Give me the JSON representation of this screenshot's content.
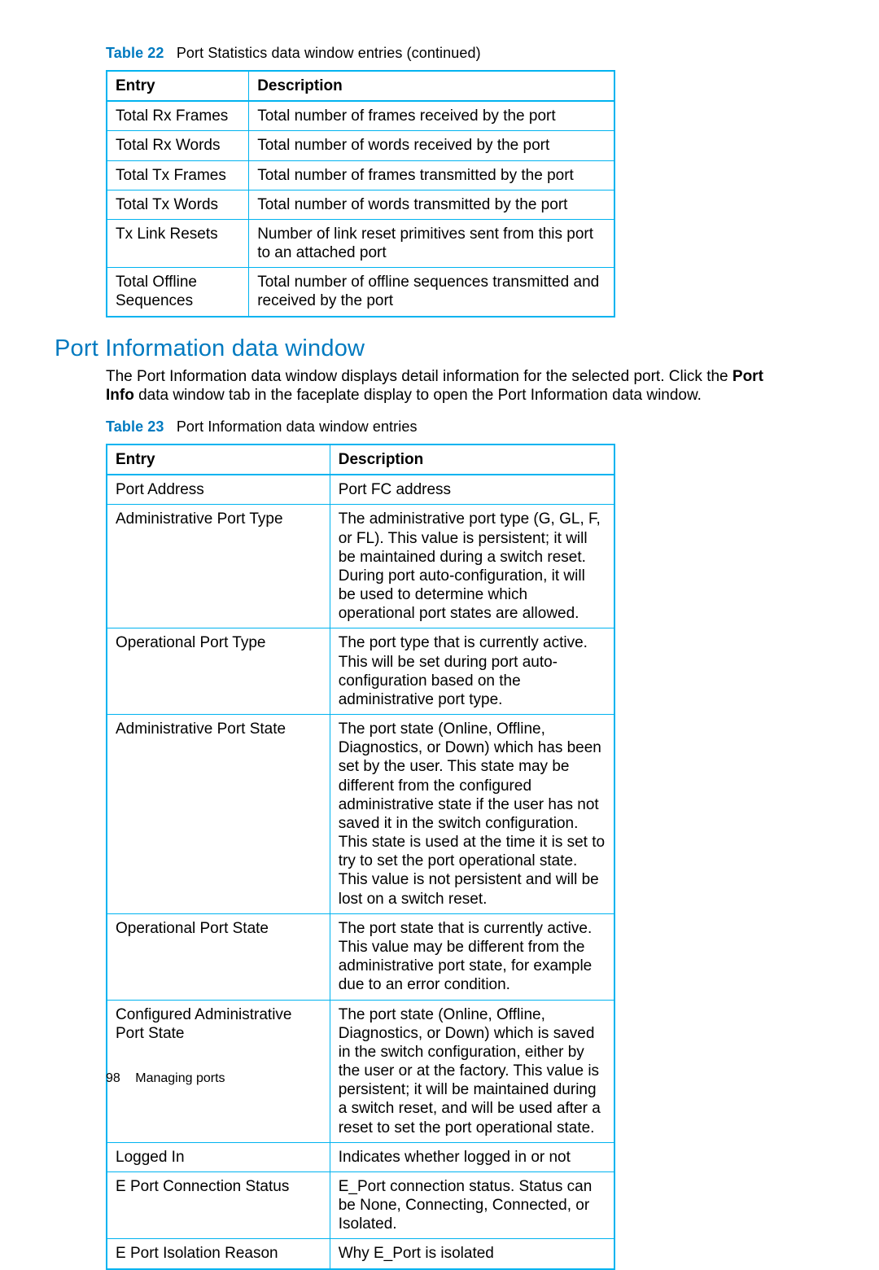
{
  "table22": {
    "label": "Table 22",
    "caption": "Port Statistics data window entries  (continued)",
    "headers": {
      "entry": "Entry",
      "description": "Description"
    },
    "rows": [
      {
        "entry": "Total Rx Frames",
        "description": "Total number of frames received by the port"
      },
      {
        "entry": "Total Rx Words",
        "description": "Total number of words received by the port"
      },
      {
        "entry": "Total Tx Frames",
        "description": "Total number of frames transmitted by the port"
      },
      {
        "entry": "Total Tx Words",
        "description": "Total number of words transmitted by the port"
      },
      {
        "entry": "Tx Link Resets",
        "description": "Number of link reset primitives sent from this port to an attached port"
      },
      {
        "entry": "Total Offline Sequences",
        "description": "Total number of offline sequences transmitted and received by the port"
      }
    ]
  },
  "section": {
    "heading": "Port Information data window",
    "para_pre": "The Port Information data window displays detail information for the selected port. Click the ",
    "para_bold": "Port Info",
    "para_post": " data window tab in the faceplate display to open the Port Information data window."
  },
  "table23": {
    "label": "Table 23",
    "caption": "Port Information data window entries",
    "headers": {
      "entry": "Entry",
      "description": "Description"
    },
    "rows": [
      {
        "entry": "Port Address",
        "description": "Port FC address"
      },
      {
        "entry": "Administrative Port Type",
        "description": "The administrative port type (G, GL, F, or FL). This value is persistent; it will be maintained during a switch reset. During port auto-configuration, it will be used to determine which operational port states are allowed."
      },
      {
        "entry": "Operational Port Type",
        "description": "The port type that is currently active. This will be set during port auto-configuration based on the administrative port type."
      },
      {
        "entry": "Administrative Port State",
        "description": "The port state (Online, Offline, Diagnostics, or Down) which has been set by the user. This state may be different from the configured administrative state if the user has not saved it in the switch configuration. This state is used at the time it is set to try to set the port operational state. This value is not persistent and will be lost on a switch reset."
      },
      {
        "entry": "Operational Port State",
        "description": "The port state that is currently active. This value may be different from the administrative port state, for example due to an error condition."
      },
      {
        "entry": "Configured Administrative Port State",
        "description": "The port state (Online, Offline, Diagnostics, or Down) which is saved in the switch configuration, either by the user or at the factory. This value is persistent; it will be maintained during a switch reset, and will be used after a reset to set the port operational state."
      },
      {
        "entry": "Logged In",
        "description": "Indicates whether logged in or not"
      },
      {
        "entry": "E Port Connection Status",
        "description": "E_Port connection status. Status can be None, Connecting, Connected, or Isolated."
      },
      {
        "entry": "E Port Isolation Reason",
        "description": "Why E_Port is isolated"
      }
    ]
  },
  "footer": {
    "page": "98",
    "section": "Managing ports"
  }
}
